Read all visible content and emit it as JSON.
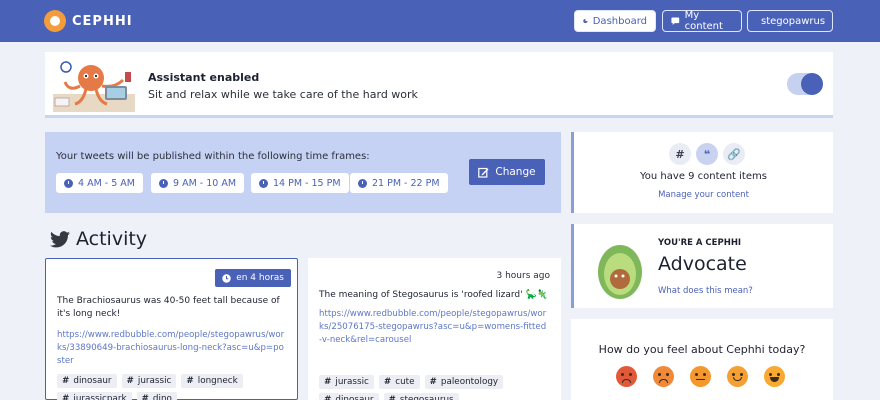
{
  "brand": {
    "name": "CEPHHI"
  },
  "nav": {
    "dashboard": "Dashboard",
    "my_content": "My content",
    "user": "stegopawrus"
  },
  "assistant": {
    "title": "Assistant enabled",
    "subtitle": "Sit and relax while we take care of the hard work",
    "enabled": true
  },
  "schedule": {
    "text": "Your tweets will be published within the following time frames:",
    "slots": [
      "4 AM - 5 AM",
      "9 AM - 10 AM",
      "14 PM - 15 PM",
      "21 PM - 22 PM"
    ],
    "change_label": "Change"
  },
  "activity": {
    "title": "Activity",
    "cards": [
      {
        "badge": "en 4 horas",
        "text": "The Brachiosaurus was 40-50 feet tall because of it's long neck!",
        "link": "https://www.redbubble.com/people/stegopawrus/works/33890649-brachiosaurus-long-neck?asc=u&p=poster",
        "tags": [
          "dinosaur",
          "jurassic",
          "longneck",
          "jurassicpark",
          "dino"
        ]
      },
      {
        "time": "3 hours ago",
        "text": "The meaning of Stegosaurus is 'roofed lizard' 🦕🦎",
        "link": "https://www.redbubble.com/people/stegopawrus/works/25076175-stegopawrus?asc=u&p=womens-fitted-v-neck&rel=carousel",
        "tags": [
          "jurassic",
          "cute",
          "paleontology",
          "dinosaur",
          "stegosaurus"
        ]
      }
    ]
  },
  "content": {
    "type_icons": [
      "hashtag-icon",
      "quote-icon",
      "link-icon"
    ],
    "count_text": "You have 9 content items",
    "manage_label": "Manage your content"
  },
  "level": {
    "kicker": "YOU'RE A CEPHHI",
    "name": "Advocate",
    "link": "What does this mean?"
  },
  "mood": {
    "question": "How do you feel about Cephhi today?",
    "faces": [
      "angry-face-icon",
      "sad-face-icon",
      "neutral-face-icon",
      "smile-face-icon",
      "happy-face-icon"
    ]
  },
  "colors": {
    "primary": "#4a61b8",
    "schedule_bg": "#c6d2f3",
    "page_bg": "#eef1f8",
    "accent_orange": "#f39c3c"
  }
}
